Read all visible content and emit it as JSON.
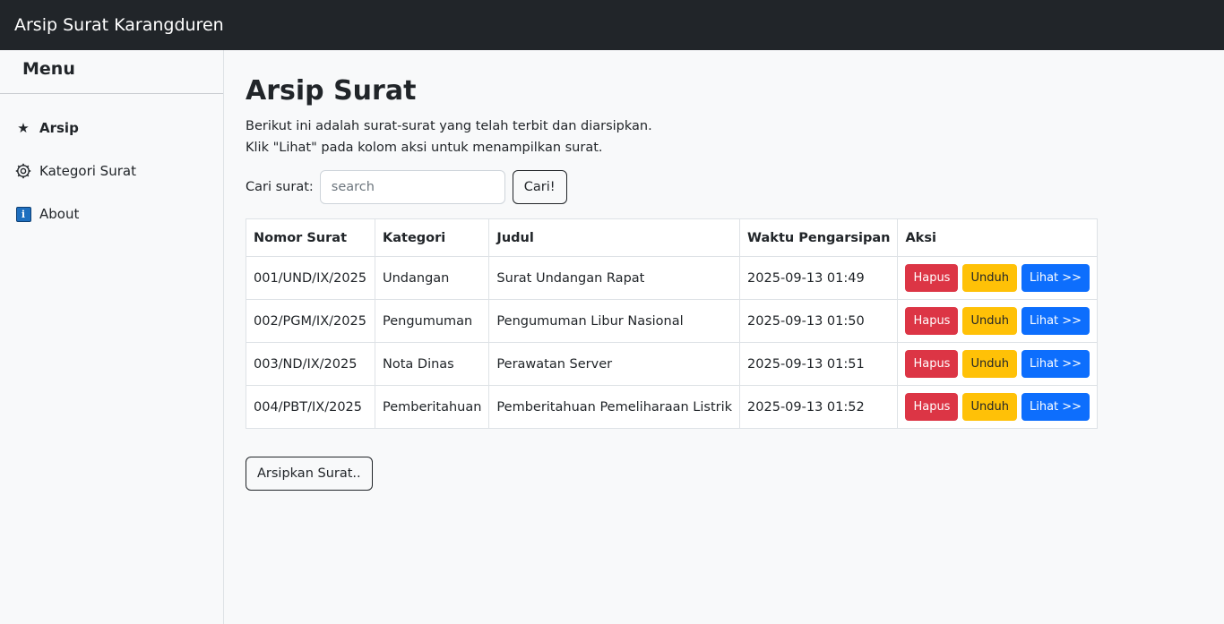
{
  "app": {
    "brand": "Arsip Surat Karangduren"
  },
  "sidebar": {
    "title": "Menu",
    "items": [
      {
        "label": "Arsip",
        "icon": "star-icon",
        "active": true
      },
      {
        "label": "Kategori Surat",
        "icon": "gear-icon",
        "active": false
      },
      {
        "label": "About",
        "icon": "info-icon",
        "active": false
      }
    ]
  },
  "main": {
    "title": "Arsip Surat",
    "lead_line1": "Berikut ini adalah surat-surat yang telah terbit dan diarsipkan.",
    "lead_line2": "Klik \"Lihat\" pada kolom aksi untuk menampilkan surat.",
    "search": {
      "label": "Cari surat:",
      "placeholder": "search",
      "value": "",
      "button": "Cari!"
    },
    "table": {
      "headers": [
        "Nomor Surat",
        "Kategori",
        "Judul",
        "Waktu Pengarsipan",
        "Aksi"
      ],
      "rows": [
        {
          "nomor": "001/UND/IX/2025",
          "kategori": "Undangan",
          "judul": "Surat Undangan Rapat",
          "waktu": "2025-09-13 01:49"
        },
        {
          "nomor": "002/PGM/IX/2025",
          "kategori": "Pengumuman",
          "judul": "Pengumuman Libur Nasional",
          "waktu": "2025-09-13 01:50"
        },
        {
          "nomor": "003/ND/IX/2025",
          "kategori": "Nota Dinas",
          "judul": "Perawatan Server",
          "waktu": "2025-09-13 01:51"
        },
        {
          "nomor": "004/PBT/IX/2025",
          "kategori": "Pemberitahuan",
          "judul": "Pemberitahuan Pemeliharaan Listrik",
          "waktu": "2025-09-13 01:52"
        }
      ],
      "actions": {
        "delete": "Hapus",
        "download": "Unduh",
        "view": "Lihat >>"
      }
    },
    "archive_button": "Arsipkan Surat.."
  },
  "colors": {
    "navbar": "#212529",
    "danger": "#dc3545",
    "warning": "#ffc107",
    "primary": "#0d6efd"
  }
}
